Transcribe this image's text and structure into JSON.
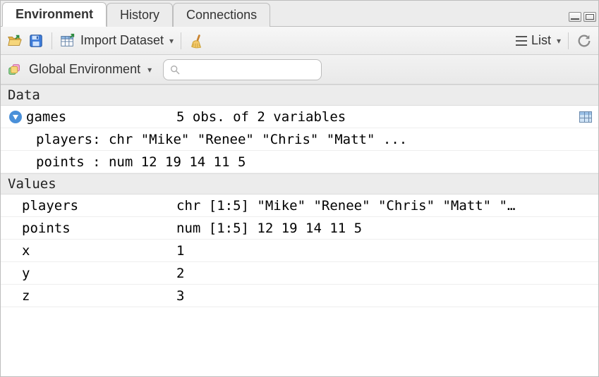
{
  "tabs": {
    "environment": "Environment",
    "history": "History",
    "connections": "Connections"
  },
  "toolbar": {
    "import_dataset": "Import Dataset",
    "view_mode": "List"
  },
  "scope": {
    "label": "Global Environment"
  },
  "search": {
    "placeholder": ""
  },
  "sections": {
    "data": "Data",
    "values": "Values"
  },
  "data_objects": {
    "games": {
      "name": "games",
      "summary": "5 obs. of 2 variables",
      "children": [
        {
          "label": "players: chr \"Mike\" \"Renee\" \"Chris\" \"Matt\" ..."
        },
        {
          "label": "points : num 12 19 14 11 5"
        }
      ]
    }
  },
  "values": [
    {
      "name": "players",
      "value": "chr [1:5] \"Mike\" \"Renee\" \"Chris\" \"Matt\" \"…"
    },
    {
      "name": "points",
      "value": "num [1:5] 12 19 14 11 5"
    },
    {
      "name": "x",
      "value": "1"
    },
    {
      "name": "y",
      "value": "2"
    },
    {
      "name": "z",
      "value": "3"
    }
  ]
}
